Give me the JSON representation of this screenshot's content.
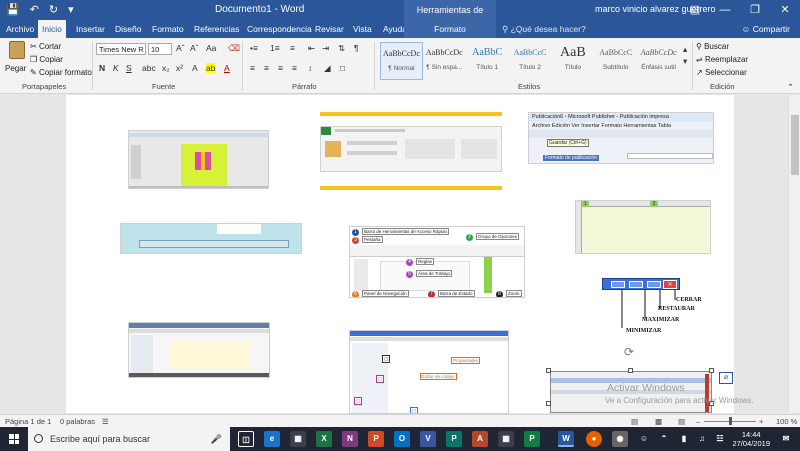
{
  "titlebar": {
    "doc_title": "Documento1  -  Word",
    "context_title": "Herramientas de imagen",
    "user": "marco vinicio alvarez guerrero"
  },
  "tabs": {
    "items": [
      {
        "label": "Archivo"
      },
      {
        "label": "Inicio"
      },
      {
        "label": "Insertar"
      },
      {
        "label": "Diseño"
      },
      {
        "label": "Formato"
      },
      {
        "label": "Referencias"
      },
      {
        "label": "Correspondencia"
      },
      {
        "label": "Revisar"
      },
      {
        "label": "Vista"
      },
      {
        "label": "Ayuda"
      },
      {
        "label": "Formato"
      }
    ],
    "tell_me": "¿Qué desea hacer?",
    "share": "Compartir"
  },
  "ribbon": {
    "clipboard": {
      "paste": "Pegar",
      "cut": "Cortar",
      "copy": "Copiar",
      "format_painter": "Copiar formato",
      "label": "Portapapeles"
    },
    "font": {
      "family": "Times New R",
      "size": "10",
      "label": "Fuente",
      "bold": "N",
      "italic": "K",
      "underline": "S"
    },
    "paragraph": {
      "label": "Párrafo"
    },
    "styles": {
      "label": "Estilos",
      "items": [
        {
          "sample": "AaBbCcDc",
          "name": "¶ Normal"
        },
        {
          "sample": "AaBbCcDc",
          "name": "¶ Sin espa..."
        },
        {
          "sample": "AaBbC",
          "name": "Título 1"
        },
        {
          "sample": "AaBbCcC",
          "name": "Título 2"
        },
        {
          "sample": "AaB",
          "name": "Título"
        },
        {
          "sample": "AaBbCcC",
          "name": "Subtítulo"
        },
        {
          "sample": "AaBbCcDc",
          "name": "Énfasis sutil"
        }
      ]
    },
    "editing": {
      "label": "Edición",
      "find": "Buscar",
      "replace": "Reemplazar",
      "select": "Seleccionar"
    }
  },
  "document": {
    "publisher_title": "Publicación6 - Microsoft Publisher - Publicación impresa",
    "publisher_menu": "Archivo  Edición  Ver  Insertar  Formato  Herramientas  Tabla",
    "publisher_tooltip": "Guardar (Ctrl+G)",
    "publisher_task": "Formato de publicación",
    "labels": {
      "barra_acceso": "Barra de Herramientas de Acceso Rápido",
      "grupo_opciones": "Grupo de Opciones",
      "pestana": "Pestaña",
      "reglas": "Reglas",
      "area_trabajo": "Área de Trabajo",
      "panel_navegacion": "Panel de Navegación",
      "barra_estado": "Barra de Estado",
      "zoom": "Zoom",
      "propiedades": "Propiedades",
      "editor_codigo": "Editor de código"
    },
    "controls": {
      "cerrar": "CERRAR",
      "restaurar": "RESTAURAR",
      "maximizar": "MAXIMIZAR",
      "minimizar": "MINIMIZAR"
    },
    "watermark": {
      "line1": "Activar Windows",
      "line2": "Ve a Configuración para activar Windows."
    }
  },
  "statusbar": {
    "page": "Página 1 de 1",
    "words": "0 palabras",
    "zoom": "100 %"
  },
  "taskbar": {
    "search_placeholder": "Escribe aquí para buscar",
    "time": "14:44",
    "date": "27/04/2019"
  },
  "colors": {
    "word_blue": "#2b579a",
    "page": "#ffffff",
    "taskbar": "#1f2532"
  }
}
